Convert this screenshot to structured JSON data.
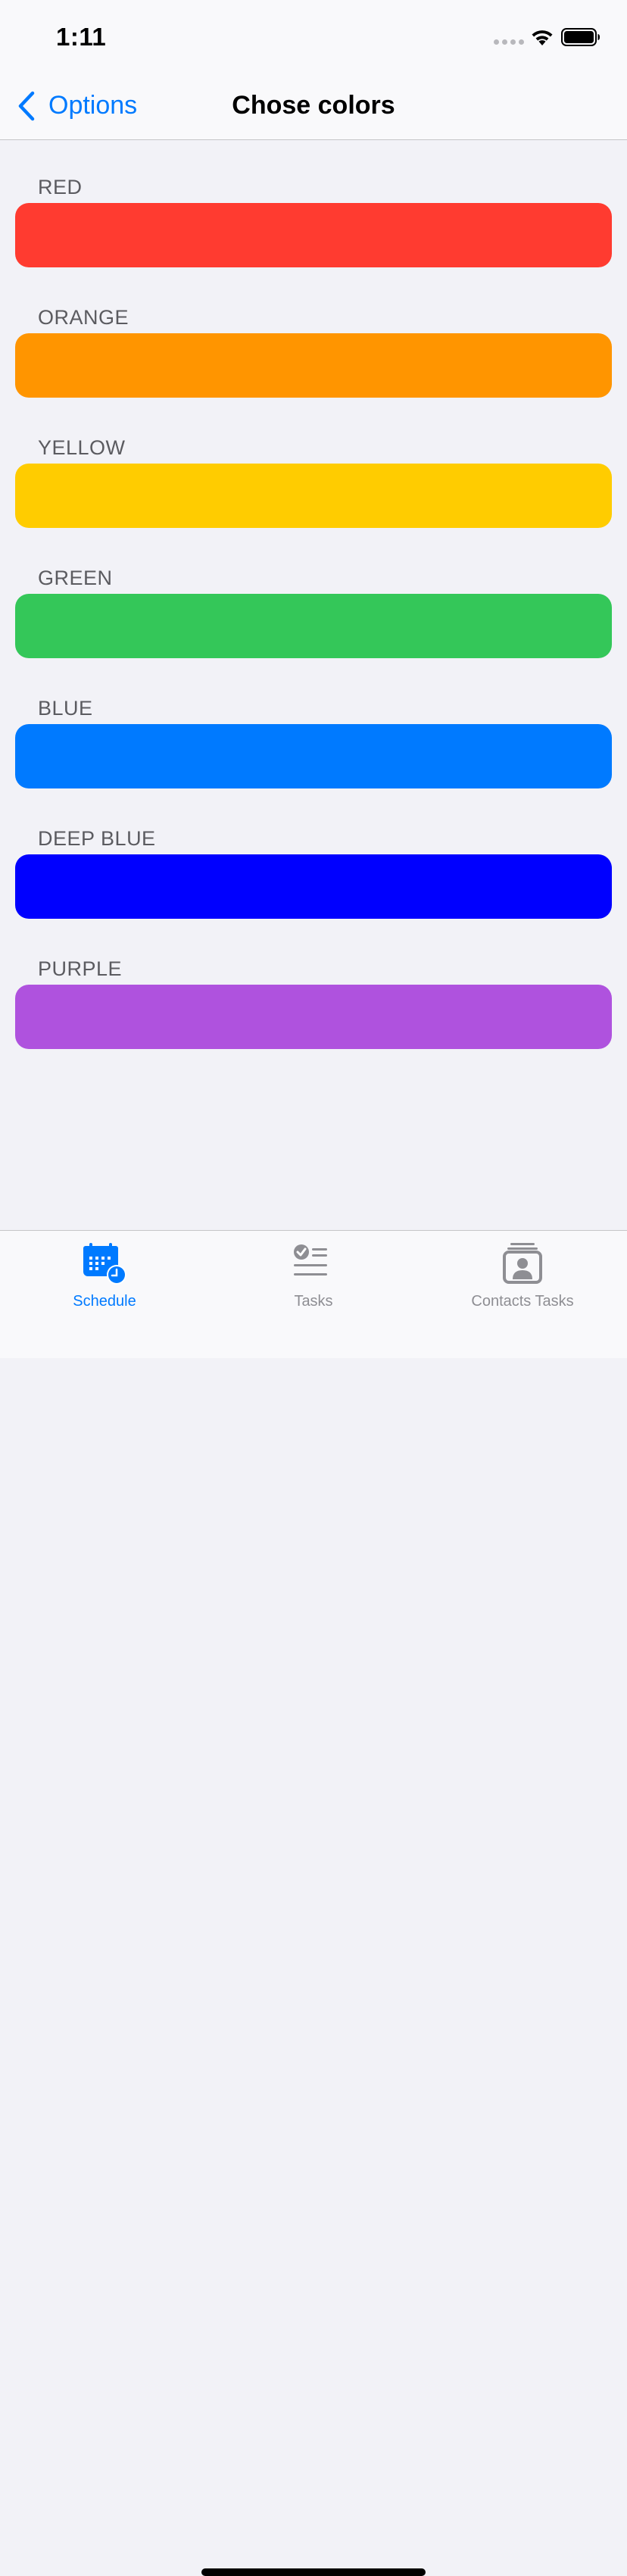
{
  "status_bar": {
    "time": "1:11"
  },
  "nav": {
    "back_label": "Options",
    "title": "Chose colors"
  },
  "colors": [
    {
      "label": "RED",
      "hex": "#ff3b30"
    },
    {
      "label": "ORANGE",
      "hex": "#ff9500"
    },
    {
      "label": "YELLOW",
      "hex": "#ffcc00"
    },
    {
      "label": "GREEN",
      "hex": "#34c759"
    },
    {
      "label": "BLUE",
      "hex": "#007aff"
    },
    {
      "label": "DEEP BLUE",
      "hex": "#0000ff"
    },
    {
      "label": "PURPLE",
      "hex": "#af52de"
    }
  ],
  "tabs": [
    {
      "label": "Schedule",
      "icon": "calendar-clock-icon",
      "active": true
    },
    {
      "label": "Tasks",
      "icon": "checklist-icon",
      "active": false
    },
    {
      "label": "Contacts Tasks",
      "icon": "contact-card-icon",
      "active": false
    }
  ],
  "theme": {
    "accent": "#007aff",
    "inactive": "#8e8e93",
    "background": "#f2f2f7"
  }
}
